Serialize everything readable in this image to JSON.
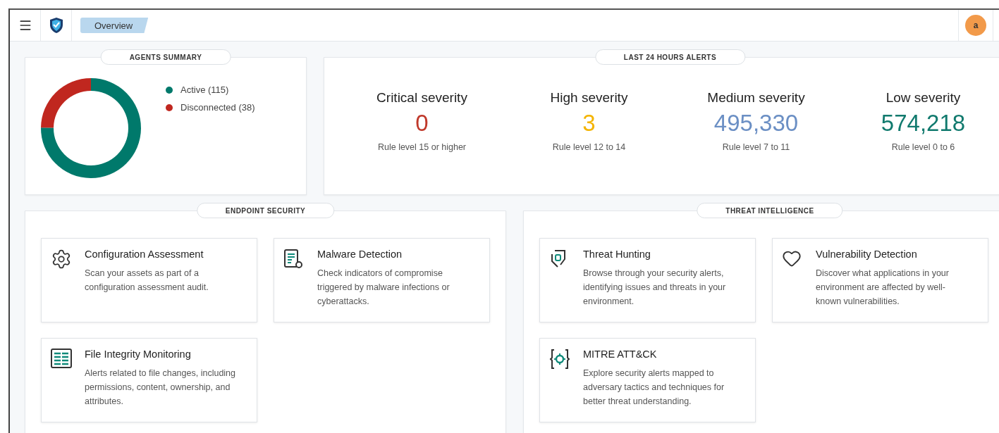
{
  "header": {
    "tab": {
      "label": "Overview",
      "selected": true
    },
    "avatar": "a"
  },
  "agents_summary": {
    "title": "AGENTS SUMMARY",
    "legend": [
      {
        "color": "#00796b"
      },
      {
        "color": "#c0271f"
      }
    ],
    "chart_data": {
      "type": "donut",
      "categories": [
        "Active (115)",
        "Disconnected (38)"
      ],
      "values": [
        115,
        38
      ]
    }
  },
  "alerts": {
    "title": "LAST 24 HOURS ALERTS",
    "items": [
      {
        "label": "Critical severity",
        "value": "0",
        "color": "#c0392b",
        "note": "Rule level 15 or higher"
      },
      {
        "label": "High severity",
        "value": "3",
        "color": "#f4b400",
        "note": "Rule level 12 to 14"
      },
      {
        "label": "Medium severity",
        "value": "495,330",
        "color": "#6b8fc4",
        "note": "Rule level 7 to 11"
      },
      {
        "label": "Low severity",
        "value": "574,218",
        "color": "#117a6e",
        "note": "Rule level 0 to 6"
      }
    ]
  },
  "panels": [
    {
      "title": "ENDPOINT SECURITY",
      "cards": [
        {
          "kind": "gear",
          "title": "Configuration Assessment",
          "text": "Scan your assets as part of a configuration assessment audit."
        },
        {
          "kind": "report",
          "title": "Malware Detection",
          "text": "Check indicators of compromise triggered by malware infections or cyberattacks."
        },
        {
          "kind": "table",
          "title": "File Integrity Monitoring",
          "text": "Alerts related to file changes, including permissions, content, ownership, and attributes."
        }
      ]
    },
    {
      "title": "THREAT INTELLIGENCE",
      "cards": [
        {
          "kind": "hunt",
          "title": "Threat Hunting",
          "text": "Browse through your security alerts, identifying issues and threats in your environment."
        },
        {
          "kind": "heart",
          "title": "Vulnerability Detection",
          "text": "Discover what applications in your environment are affected by well-known vulnerabilities."
        },
        {
          "kind": "target",
          "title": "MITRE ATT&CK",
          "text": "Explore security alerts mapped to adversary tactics and techniques for better threat understanding."
        }
      ]
    }
  ]
}
